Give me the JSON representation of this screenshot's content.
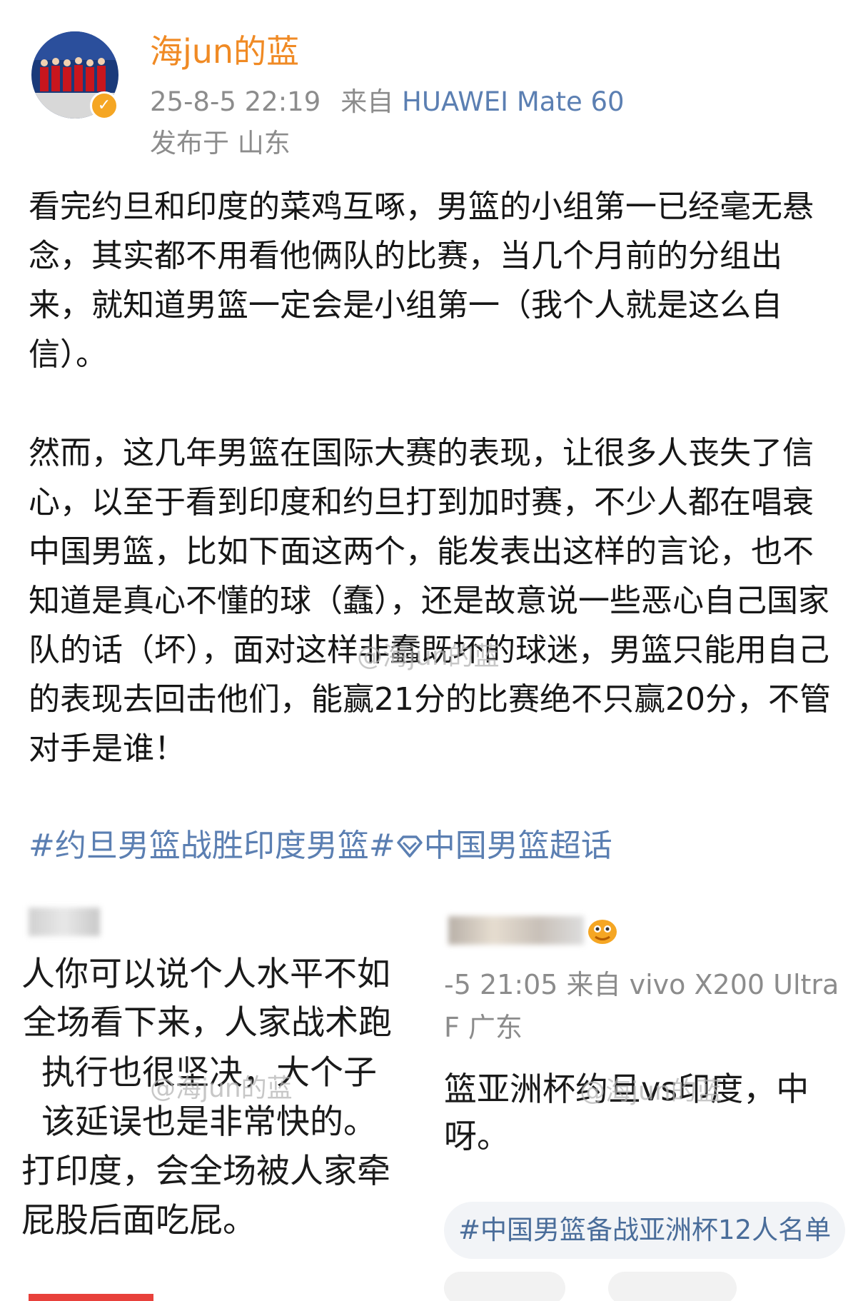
{
  "post": {
    "username": "海jun的蓝",
    "timestamp": "25-8-5 22:19",
    "source_prefix": "来自",
    "device": "HUAWEI Mate 60",
    "location": "发布于 山东",
    "paragraph1": "看完约旦和印度的菜鸡互啄，男篮的小组第一已经毫无悬念，其实都不用看他俩队的比赛，当几个月前的分组出来，就知道男篮一定会是小组第一（我个人就是这么自信）。",
    "paragraph2": "然而，这几年男篮在国际大赛的表现，让很多人丧失了信心，以至于看到印度和约旦打到加时赛，不少人都在唱衰中国男篮，比如下面这两个，能发表出这样的言论，也不知道是真心不懂的球（蠢），还是故意说一些恶心自己国家队的话（坏），面对这样非蠢既坏的球迷，男篮只能用自己的表现去回击他们，能赢21分的比赛绝不只赢20分，不管对手是谁！",
    "tag1": "#约旦男篮战胜印度男篮#",
    "tag2": "中国男篮超话",
    "watermark": "@海jun的蓝"
  },
  "screenshot_left": {
    "lines": [
      "人你可以说个人水平不如",
      "全场看下来，人家战术跑",
      "执行也很坚决，大个子",
      "该延误也是非常快的。",
      "打印度，会全场被人家牵",
      "屁股后面吃屁。"
    ],
    "watermark": "@海jun的蓝"
  },
  "screenshot_right": {
    "meta": "-5 21:05  来自 vivo X200 Ultra",
    "location": "F 广东",
    "lines": [
      "篮亚洲杯约旦vs印度，中",
      "呀。"
    ],
    "watermark": "@海jun的蓝",
    "tag": "#中国男篮备战亚洲杯12人名单"
  },
  "colors": {
    "username": "#f08a24",
    "meta_gray": "#8c8c8c",
    "topic_blue": "#5b7fb2",
    "badge_gold": "#f5a623",
    "tab_red": "#e8413b"
  },
  "icons": [
    "verified-badge-icon",
    "super-topic-diamond-icon",
    "emoji-sticker-icon"
  ]
}
